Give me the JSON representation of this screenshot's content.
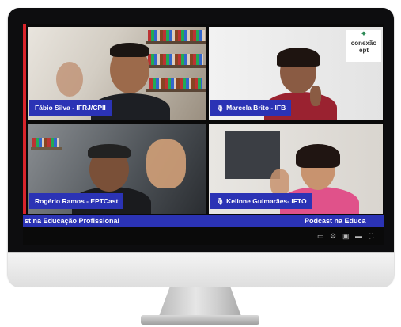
{
  "participants": [
    {
      "name": "Fábio Silva - IFRJ/CPII",
      "muted": false
    },
    {
      "name": "Marcela Brito - IFB",
      "muted": true
    },
    {
      "name": "Rogério Ramos - EPTCast",
      "muted": false
    },
    {
      "name": "Kelinne Guimarães- IFTO",
      "muted": true
    }
  ],
  "logo": {
    "line1": "conexão",
    "line2": "ept"
  },
  "ticker": {
    "left_text": "st na Educação Profissional",
    "right_text": "Podcast na Educa"
  },
  "icons": {
    "mic": "muted-mic-icon"
  },
  "colors": {
    "nameplate": "#2b33b5",
    "accent": "#d8242b"
  }
}
